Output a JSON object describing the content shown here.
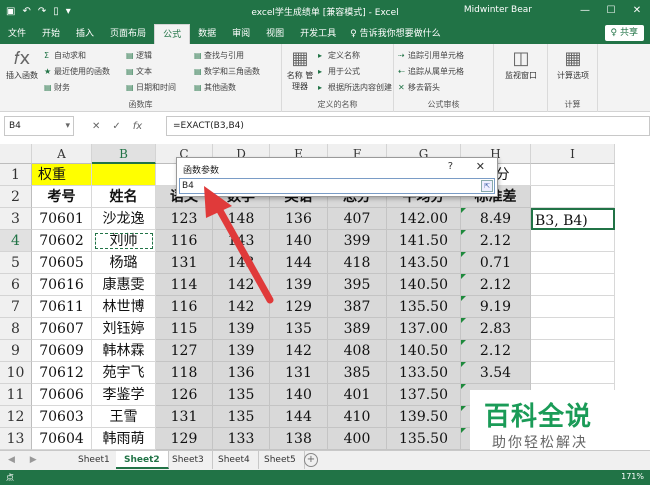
{
  "titlebar": {
    "qat_icons": [
      "save-icon",
      "undo-icon",
      "redo-icon",
      "new-file-icon",
      "customize-icon"
    ],
    "title": "excel学生成绩单 [兼容模式] - Excel",
    "user": "Midwinter Bear",
    "minimize": "—",
    "restore": "☐",
    "close": "✕"
  },
  "tabs": [
    "文件",
    "开始",
    "插入",
    "页面布局",
    "公式",
    "数据",
    "审阅",
    "视图",
    "开发工具"
  ],
  "active_tab": "公式",
  "tell_me": "♀ 告诉我你想要做什么",
  "share": "♀ 共享",
  "ribbon": {
    "insert_function": "插入函数",
    "autosum": "自动求和",
    "recent": "最近使用的函数",
    "finance": "财务",
    "logical": "逻辑",
    "text": "文本",
    "datetime": "日期和时间",
    "lookup": "查找与引用",
    "math": "数学和三角函数",
    "other": "其他函数",
    "group_library": "函数库",
    "name_manager": "名称\n管理器",
    "define_name": "定义名称",
    "use_in_formula": "用于公式",
    "create_from_sel": "根据所选内容创建",
    "group_names": "定义的名称",
    "trace_precedents": "追踪引用单元格",
    "trace_dependents": "追踪从属单元格",
    "remove_arrows": "移去箭头",
    "group_audit": "公式审核",
    "watch_window": "监视窗口",
    "calc_options": "计算选项",
    "group_calc": "计算"
  },
  "formula_bar": {
    "name_box": "B4",
    "cancel": "✕",
    "enter": "✓",
    "fx": "fx",
    "formula": "=EXACT(B3,B4)"
  },
  "columns": [
    "A",
    "B",
    "C",
    "D",
    "E",
    "F",
    "G",
    "H",
    "I"
  ],
  "rows": [
    "1",
    "2",
    "3",
    "4",
    "5",
    "6",
    "7",
    "8",
    "9",
    "10",
    "11",
    "12",
    "13"
  ],
  "sheet": {
    "r1_a": "权重",
    "r1_h": "学分",
    "headers": [
      "考号",
      "姓名",
      "语文",
      "数学",
      "英语",
      "总分",
      "平均分",
      "标准差"
    ],
    "data": [
      [
        "70601",
        "沙龙逸",
        "123",
        "148",
        "136",
        "407",
        "142.00",
        "8.49"
      ],
      [
        "70602",
        "刘帅",
        "116",
        "143",
        "140",
        "399",
        "141.50",
        "2.12"
      ],
      [
        "70605",
        "杨璐",
        "131",
        "143",
        "144",
        "418",
        "143.50",
        "0.71"
      ],
      [
        "70616",
        "康惠雯",
        "114",
        "142",
        "139",
        "395",
        "140.50",
        "2.12"
      ],
      [
        "70611",
        "林世博",
        "116",
        "142",
        "129",
        "387",
        "135.50",
        "9.19"
      ],
      [
        "70607",
        "刘钰婷",
        "115",
        "139",
        "135",
        "389",
        "137.00",
        "2.83"
      ],
      [
        "70609",
        "韩林霖",
        "127",
        "139",
        "142",
        "408",
        "140.50",
        "2.12"
      ],
      [
        "70612",
        "苑宇飞",
        "118",
        "136",
        "131",
        "385",
        "133.50",
        "3.54"
      ],
      [
        "70606",
        "李鉴学",
        "126",
        "135",
        "140",
        "401",
        "137.50",
        ""
      ],
      [
        "70603",
        "王雪",
        "131",
        "135",
        "144",
        "410",
        "139.50",
        ""
      ],
      [
        "70604",
        "韩雨萌",
        "129",
        "133",
        "138",
        "400",
        "135.50",
        ""
      ]
    ],
    "active_cell_text": "B3, B4)"
  },
  "dialog": {
    "title": "函数参数",
    "help": "?",
    "close": "✕",
    "input": "B4",
    "collapse": "⇱"
  },
  "sheet_tabs": [
    "Sheet1",
    "Sheet2",
    "Sheet3",
    "Sheet4",
    "Sheet5"
  ],
  "active_sheet": "Sheet2",
  "sheet_nav": "◀ ▶",
  "sheet_add": "+",
  "watermark": {
    "main": "百科全说",
    "sub": "助你轻松解决"
  },
  "status": {
    "mode": "点",
    "zoom": "171%"
  },
  "colors": {
    "excel_green": "#217346",
    "highlight_yellow": "#ffff00",
    "arrow_red": "#e03a3a",
    "watermark_green": "#1a9b57"
  }
}
